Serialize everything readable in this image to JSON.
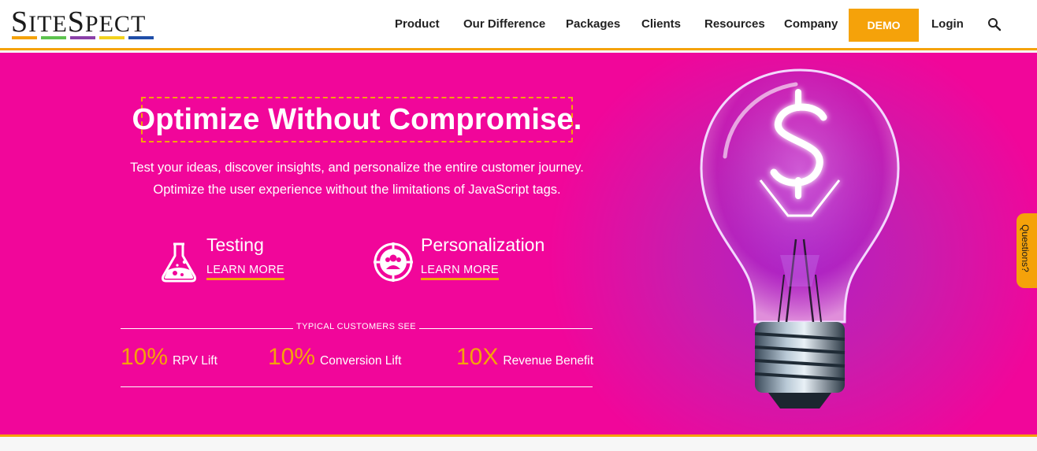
{
  "brand": {
    "name_first": "S",
    "name_rest1": "ITE",
    "name_mid": "S",
    "name_rest2": "PECT",
    "bar_colors": [
      "#f5a20a",
      "#5cc34e",
      "#8a3fa8",
      "#f3d21e",
      "#1f4ea8"
    ]
  },
  "nav": {
    "items": [
      "Product",
      "Our Difference",
      "Packages",
      "Clients",
      "Resources",
      "Company"
    ],
    "demo_label": "DEMO",
    "login_label": "Login",
    "search_icon": "search-icon"
  },
  "hero": {
    "headline": "Optimize Without Compromise.",
    "subtext": "Test your ideas, discover insights, and personalize the entire customer journey. Optimize the user experience without the limitations of JavaScript tags.",
    "features": [
      {
        "title": "Testing",
        "link": "LEARN MORE",
        "icon": "flask-icon"
      },
      {
        "title": "Personalization",
        "link": "LEARN MORE",
        "icon": "users-target-icon"
      }
    ],
    "stats_caption": "TYPICAL CUSTOMERS SEE",
    "stats": [
      {
        "value": "10%",
        "label": "RPV Lift"
      },
      {
        "value": "10%",
        "label": "Conversion Lift"
      },
      {
        "value": "10X",
        "label": "Revenue Benefit"
      }
    ]
  },
  "questions_tab": "Questions?",
  "colors": {
    "accent": "#f5a20a",
    "hero_bg": "#f1069a",
    "bulb_glow": "#b21fc4"
  }
}
